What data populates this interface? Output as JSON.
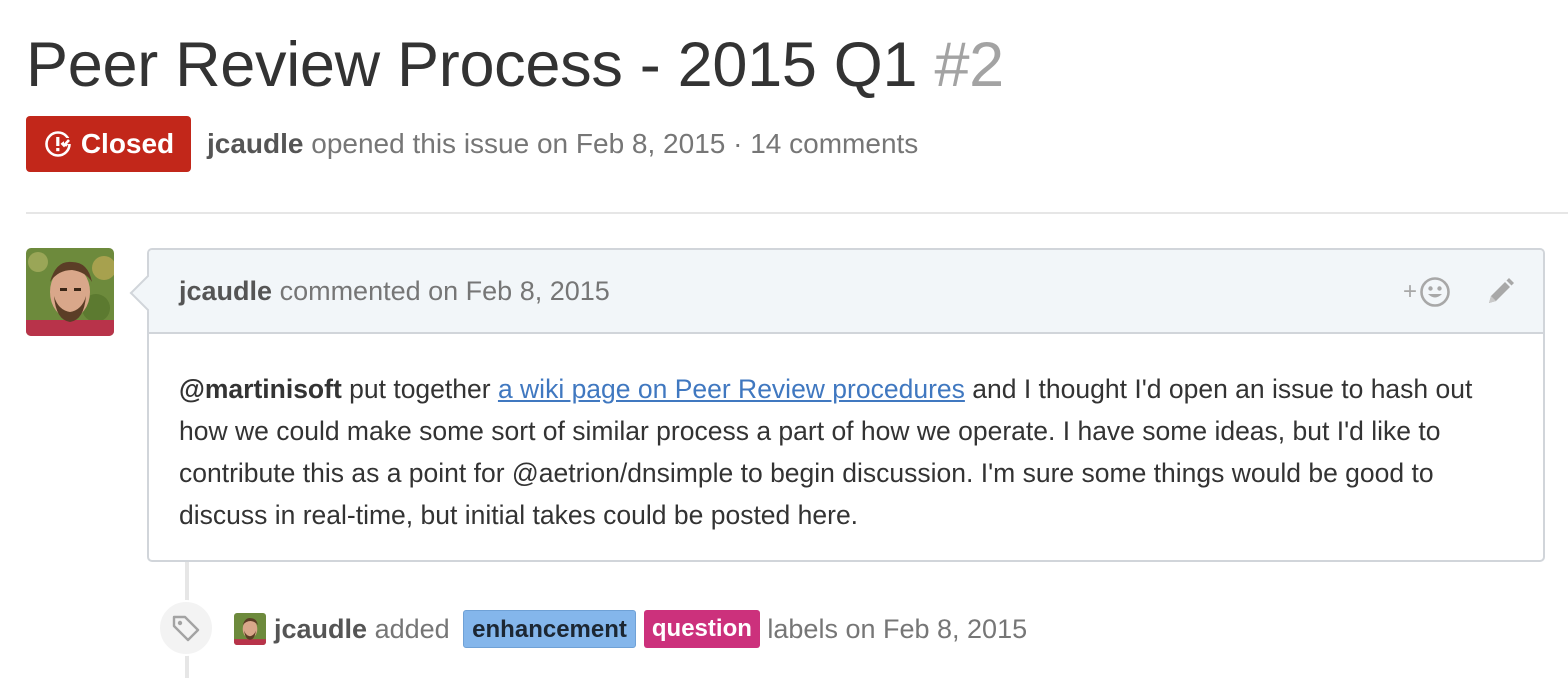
{
  "issue": {
    "title": "Peer Review Process - 2015 Q1",
    "number": "#2",
    "state": "Closed",
    "state_color": "#c2271a",
    "author": "jcaudle",
    "opened_text": "opened this issue on Feb 8, 2015 · 14 comments"
  },
  "comment": {
    "author": "jcaudle",
    "action": "commented on Feb 8, 2015",
    "reaction_icon": "smiley-icon",
    "edit_icon": "pencil-icon",
    "body": {
      "mention": "@martinisoft",
      "text_before_link": " put together ",
      "link_text": "a wiki page on Peer Review procedures",
      "text_after_link": " and I thought I'd open an issue to hash out how we could make some sort of similar process a part of how we operate. I have some ideas, but I'd like to contribute this as a point for @aetrion/dnsimple to begin discussion. I'm sure some things would be good to discuss in real-time, but initial takes could be posted here."
    }
  },
  "event": {
    "icon": "tag-icon",
    "author": "jcaudle",
    "action": "added",
    "labels": [
      {
        "name": "enhancement",
        "color": "#84b6eb"
      },
      {
        "name": "question",
        "color": "#cc317c"
      }
    ],
    "suffix": "labels on Feb 8, 2015"
  }
}
